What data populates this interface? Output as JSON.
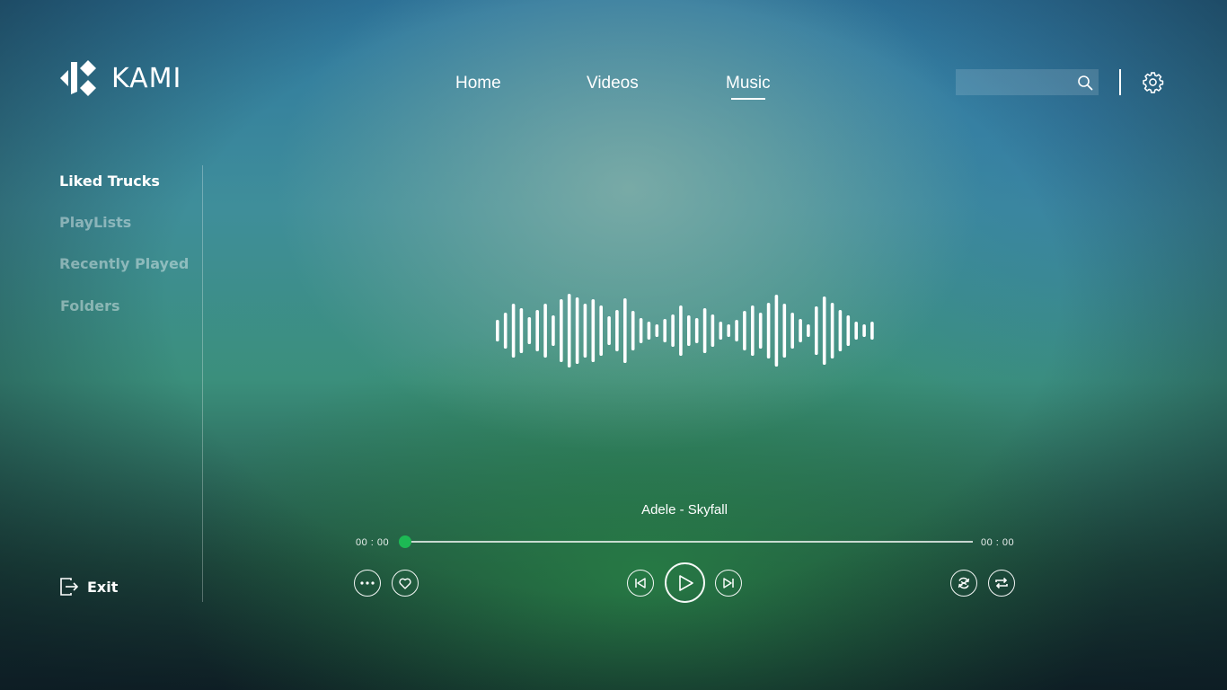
{
  "app": {
    "title": "KAMI"
  },
  "nav": {
    "items": [
      {
        "label": "Home",
        "active": false
      },
      {
        "label": "Videos",
        "active": false
      },
      {
        "label": "Music",
        "active": true
      }
    ]
  },
  "search": {
    "value": "",
    "placeholder": "",
    "icon": "search-icon"
  },
  "settings": {
    "icon": "gear-icon"
  },
  "sidebar": {
    "items": [
      {
        "label": "Liked Trucks",
        "active": true
      },
      {
        "label": "PlayLists",
        "active": false
      },
      {
        "label": "Recently Played",
        "active": false
      },
      {
        "label": "Folders",
        "active": false
      }
    ],
    "exit_label": "Exit",
    "exit_icon": "logout-icon"
  },
  "player": {
    "track_title": "Adele - Skyfall",
    "elapsed": "00 : 00",
    "duration": "00 : 00",
    "progress_fraction": 0,
    "accent_color": "#1db954",
    "controls": {
      "more": "more-icon",
      "like": "heart-icon",
      "previous": "skip-previous-icon",
      "play": "play-icon",
      "next": "skip-next-icon",
      "shuffle": "shuffle-icon",
      "repeat": "repeat-icon"
    }
  }
}
